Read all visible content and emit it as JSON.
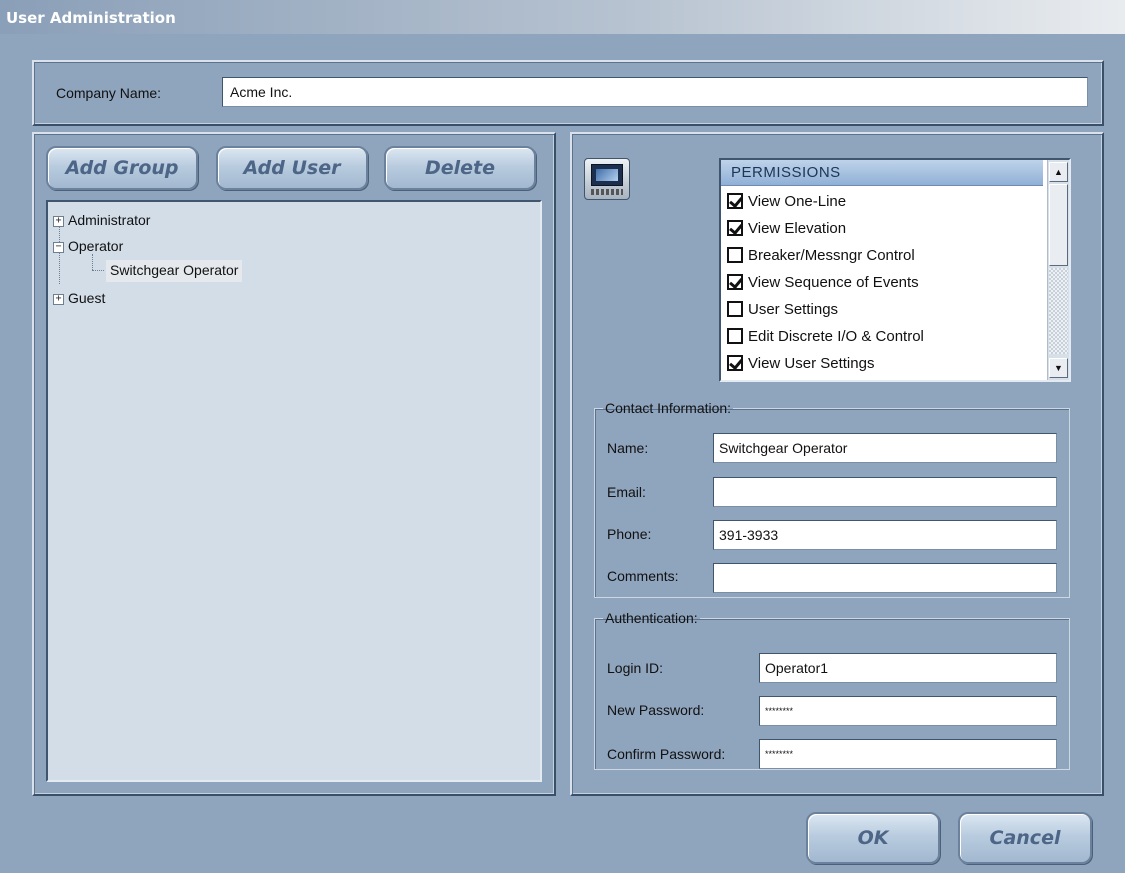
{
  "window": {
    "title": "User Administration"
  },
  "company": {
    "label": "Company Name:",
    "value": "Acme Inc."
  },
  "toolbar": {
    "add_group": "Add Group",
    "add_user": "Add User",
    "delete": "Delete"
  },
  "tree": {
    "nodes": [
      {
        "label": "Administrator",
        "expander": "+"
      },
      {
        "label": "Operator",
        "expander": "−"
      },
      {
        "label": "Switchgear Operator"
      },
      {
        "label": "Guest",
        "expander": "+"
      }
    ]
  },
  "permissions": {
    "header": "PERMISSIONS",
    "items": [
      {
        "label": "View One-Line",
        "checked": true
      },
      {
        "label": "View Elevation",
        "checked": true
      },
      {
        "label": "Breaker/Messngr Control",
        "checked": false
      },
      {
        "label": "View Sequence of Events",
        "checked": true
      },
      {
        "label": "User Settings",
        "checked": false
      },
      {
        "label": "Edit Discrete I/O & Control",
        "checked": false
      },
      {
        "label": "View User Settings",
        "checked": true
      }
    ]
  },
  "contact": {
    "legend": "Contact Information:",
    "name_label": "Name:",
    "name_value": "Switchgear Operator",
    "email_label": "Email:",
    "email_value": "",
    "phone_label": "Phone:",
    "phone_value": "391-3933",
    "comments_label": "Comments:",
    "comments_value": ""
  },
  "auth": {
    "legend": "Authentication:",
    "login_label": "Login ID:",
    "login_value": "Operator1",
    "new_pw_label": "New Password:",
    "new_pw_value": "********",
    "confirm_pw_label": "Confirm Password:",
    "confirm_pw_value": "********"
  },
  "footer": {
    "ok": "OK",
    "cancel": "Cancel"
  },
  "icons": {
    "device": "hmi-panel-icon",
    "cursor": "mouse-pointer-icon"
  },
  "colors": {
    "background": "#8fa4bd",
    "button_text": "#4d6586",
    "tree_bg": "#d3dde8"
  }
}
